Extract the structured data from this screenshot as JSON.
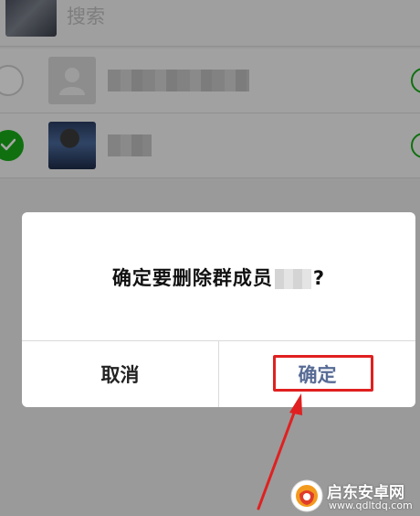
{
  "search": {
    "label": "搜索"
  },
  "members": [
    {
      "state": "unchecked",
      "avatar": "placeholder-avatar"
    },
    {
      "state": "checked",
      "avatar": "photo-avatar"
    }
  ],
  "dialog": {
    "message_prefix": "确定要删除群成员",
    "message_suffix": "?",
    "cancel_label": "取消",
    "confirm_label": "确定"
  },
  "colors": {
    "confirm_text": "#576b95",
    "highlight": "#e02020",
    "check_green": "#1aad19"
  },
  "watermark": {
    "title": "启东安卓网",
    "url": "www.qdltdq.com"
  }
}
